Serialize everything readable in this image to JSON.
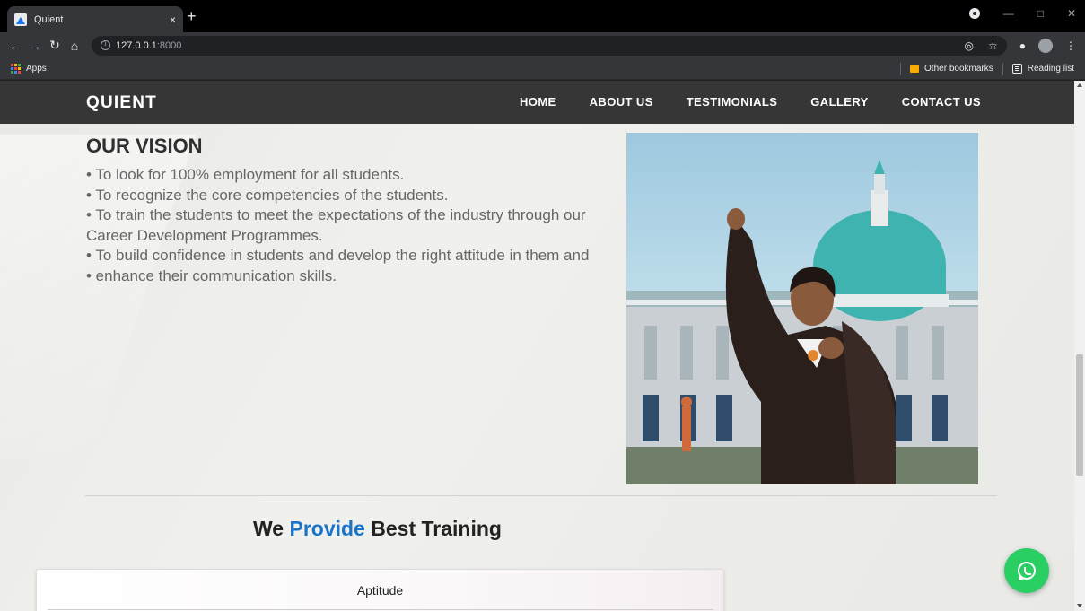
{
  "browser": {
    "tab_title": "Quient",
    "tab_close": "×",
    "new_tab": "+",
    "url_host": "127.0.0.1",
    "url_port": ":8000",
    "bookmarks": {
      "apps_label": "Apps",
      "other_bookmarks": "Other bookmarks",
      "reading_list": "Reading list"
    }
  },
  "site": {
    "brand": "QUIENT",
    "nav": [
      {
        "label": "HOME"
      },
      {
        "label": "ABOUT US"
      },
      {
        "label": "TESTIMONIALS"
      },
      {
        "label": "GALLERY"
      },
      {
        "label": "CONTACT US"
      }
    ]
  },
  "vision": {
    "heading": "OUR VISION",
    "lines": [
      "• To look for 100% employment for all students.",
      "• To recognize the core competencies of the students.",
      "• To train the students to meet the expectations of the industry through our Career Development Programmes.",
      "• To build confidence in students and develop the right attitude in them and",
      "• enhance their communication skills."
    ]
  },
  "training": {
    "heading_pre": "We ",
    "heading_accent": "Provide",
    "heading_post": " Best Training",
    "card_title": "Aptitude"
  },
  "colors": {
    "navbar": "#363636",
    "accent": "#1a73c8",
    "whatsapp": "#29cf62"
  },
  "icons": {
    "floating_button": "whatsapp-icon"
  }
}
